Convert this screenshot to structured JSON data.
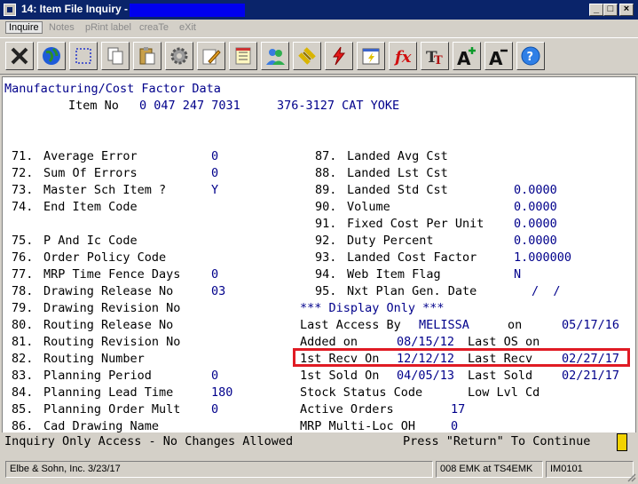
{
  "window": {
    "title": "14: Item File Inquiry -",
    "controls": [
      "_",
      "□",
      "×"
    ]
  },
  "menu": [
    {
      "label": "Inquire",
      "active": true
    },
    {
      "label": "Notes",
      "active": false
    },
    {
      "label": "pRint label",
      "active": false
    },
    {
      "label": "creaTe",
      "active": false
    },
    {
      "label": "eXit",
      "active": false
    }
  ],
  "toolbar": [
    "exit-icon",
    "globe-icon",
    "select-icon",
    "copy-icon",
    "paste-icon",
    "settings-gear-icon",
    "edit-pencil-icon",
    "notepad-icon",
    "users-icon",
    "link-icon",
    "lightning-icon",
    "edit-lightning-icon",
    "function-icon",
    "font-tt-icon",
    "font-larger-icon",
    "font-smaller-icon",
    "help-icon"
  ],
  "screen": {
    "heading": "Manufacturing/Cost Factor Data",
    "item_label": "Item No",
    "item_no": "0 047 247 7031",
    "item_desc": "376-3127 CAT YOKE",
    "left": [
      {
        "num": "71.",
        "label": "Average Error",
        "value": "0"
      },
      {
        "num": "72.",
        "label": "Sum Of Errors",
        "value": "0"
      },
      {
        "num": "73.",
        "label": "Master Sch Item ?",
        "value": "Y"
      },
      {
        "num": "74.",
        "label": "End Item Code",
        "value": ""
      },
      {
        "num": "75.",
        "label": "P And Ic Code",
        "value": ""
      },
      {
        "num": "76.",
        "label": "Order Policy Code",
        "value": ""
      },
      {
        "num": "77.",
        "label": "MRP Time Fence Days",
        "value": "0"
      },
      {
        "num": "78.",
        "label": "Drawing Release No",
        "value": "03"
      },
      {
        "num": "79.",
        "label": "Drawing Revision No",
        "value": ""
      },
      {
        "num": "80.",
        "label": "Routing Release No",
        "value": ""
      },
      {
        "num": "81.",
        "label": "Routing Revision No",
        "value": ""
      },
      {
        "num": "82.",
        "label": "Routing Number",
        "value": ""
      },
      {
        "num": "83.",
        "label": "Planning Period",
        "value": "0"
      },
      {
        "num": "84.",
        "label": "Planning Lead Time",
        "value": "180"
      },
      {
        "num": "85.",
        "label": "Planning Order Mult",
        "value": "0"
      },
      {
        "num": "86.",
        "label": "Cad Drawing Name",
        "value": ""
      }
    ],
    "right": [
      {
        "num": "87.",
        "label": "Landed Avg Cst",
        "value": ""
      },
      {
        "num": "88.",
        "label": "Landed Lst Cst",
        "value": ""
      },
      {
        "num": "89.",
        "label": "Landed Std Cst",
        "value": "0.0000"
      },
      {
        "num": "90.",
        "label": "Volume",
        "value": "0.0000"
      },
      {
        "num": "91.",
        "label": "Fixed Cost Per Unit",
        "value": "0.0000"
      },
      {
        "num": "92.",
        "label": "Duty Percent",
        "value": "0.0000"
      },
      {
        "num": "93.",
        "label": "Landed Cost Factor",
        "value": "1.000000"
      },
      {
        "num": "94.",
        "label": "Web Item Flag",
        "value": "N"
      },
      {
        "num": "95.",
        "label": "Nxt Plan Gen. Date",
        "value": "/  /"
      }
    ],
    "display_only": "*** Display Only ***",
    "last_access_label": "Last Access By",
    "last_access_user": "MELISSA",
    "on_label": "on",
    "last_access_date": "05/17/16",
    "added_label": "Added on",
    "added_date": "08/15/12",
    "last_os_label": "Last OS on",
    "first_recv_label": "1st Recv On",
    "first_recv_date": "12/12/12",
    "last_recv_label": "Last Recv",
    "last_recv_date": "02/27/17",
    "first_sold_label": "1st Sold On",
    "first_sold_date": "04/05/13",
    "last_sold_label": "Last Sold",
    "last_sold_date": "02/21/17",
    "stock_status_label": "Stock Status Code",
    "low_lvl_label": "Low Lvl Cd",
    "active_orders_label": "Active Orders",
    "active_orders": "17",
    "mrp_multi_label": "MRP Multi-Loc OH",
    "mrp_multi": "0"
  },
  "message": {
    "left": "Inquiry Only Access - No Changes Allowed",
    "right": "Press \"Return\" To Continue"
  },
  "statusbar": {
    "company": "Elbe & Sohn, Inc. 3/23/17",
    "session": "008 EMK at TS4EMK",
    "program": "IM0101"
  },
  "colors": {
    "title_bg": "#0a246a",
    "value_text": "#00008b",
    "highlight": "#e01b24",
    "cursor": "#f2d200"
  }
}
